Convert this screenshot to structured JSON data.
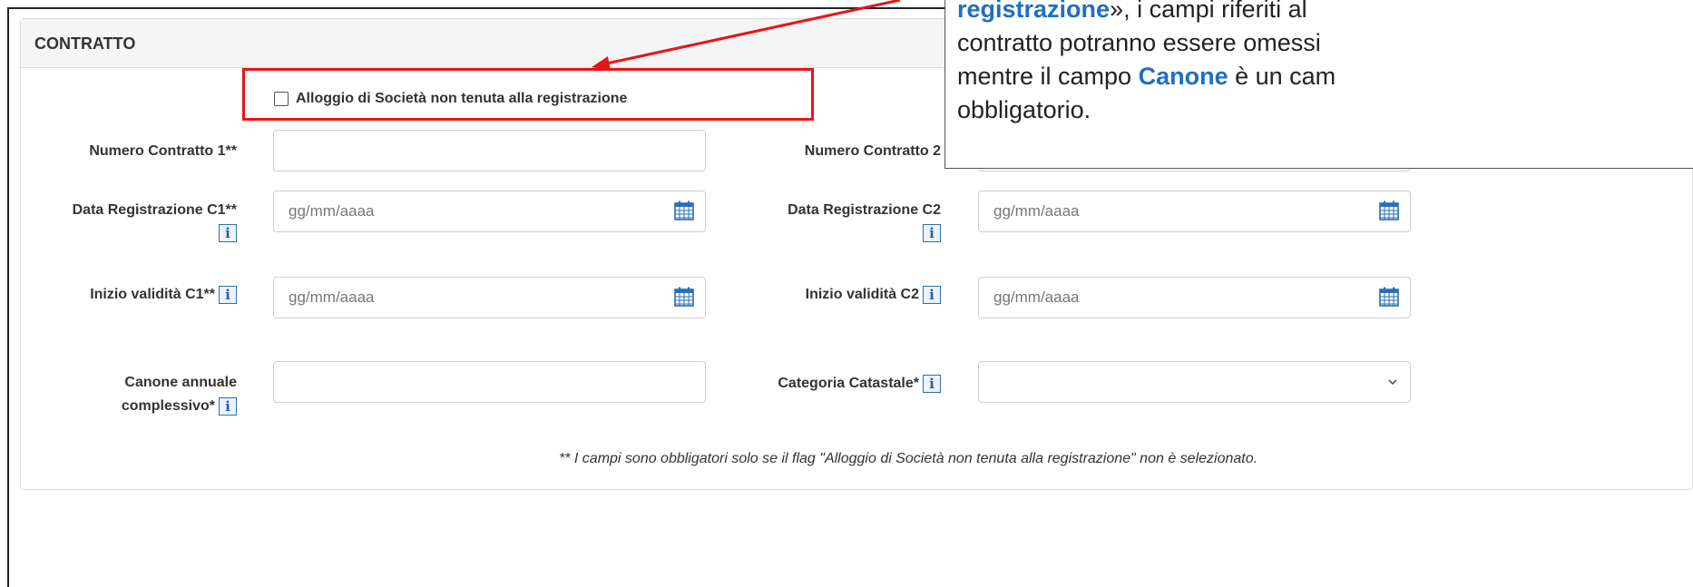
{
  "panel": {
    "title": "CONTRATTO"
  },
  "checkbox": {
    "label": "Alloggio di Società non tenuta alla registrazione",
    "checked": false
  },
  "fields": {
    "numero_contratto_1": {
      "label": "Numero Contratto 1**",
      "value": ""
    },
    "numero_contratto_2": {
      "label": "Numero Contratto 2",
      "value": ""
    },
    "data_registrazione_c1": {
      "label": "Data Registrazione C1**",
      "placeholder": "gg/mm/aaaa"
    },
    "data_registrazione_c2": {
      "label": "Data Registrazione C2",
      "placeholder": "gg/mm/aaaa"
    },
    "inizio_validita_c1": {
      "label": "Inizio validità C1**",
      "placeholder": "gg/mm/aaaa"
    },
    "inizio_validita_c2": {
      "label": "Inizio validità C2",
      "placeholder": "gg/mm/aaaa"
    },
    "canone_annuale": {
      "label_line1": "Canone annuale",
      "label_line2": "complessivo*",
      "value": ""
    },
    "categoria_catastale": {
      "label": "Categoria Catastale*",
      "value": ""
    }
  },
  "footnote": "** I campi sono obbligatori solo se il flag \"Alloggio di Società non tenuta alla registrazione\" non è selezionato.",
  "callout": {
    "line1_highlight": "registrazione",
    "line1_rest": "», i campi riferiti al",
    "line2": "contratto potranno essere omessi",
    "line3_pre": "mentre il campo ",
    "line3_highlight": "Canone",
    "line3_post": " è un cam",
    "line4": "obbligatorio."
  },
  "colors": {
    "accent_blue": "#1f6fc2",
    "highlight_red": "#e8141b"
  },
  "icons": {
    "info": "i",
    "calendar": "calendar-icon",
    "chevron": "chevron-down-icon"
  }
}
